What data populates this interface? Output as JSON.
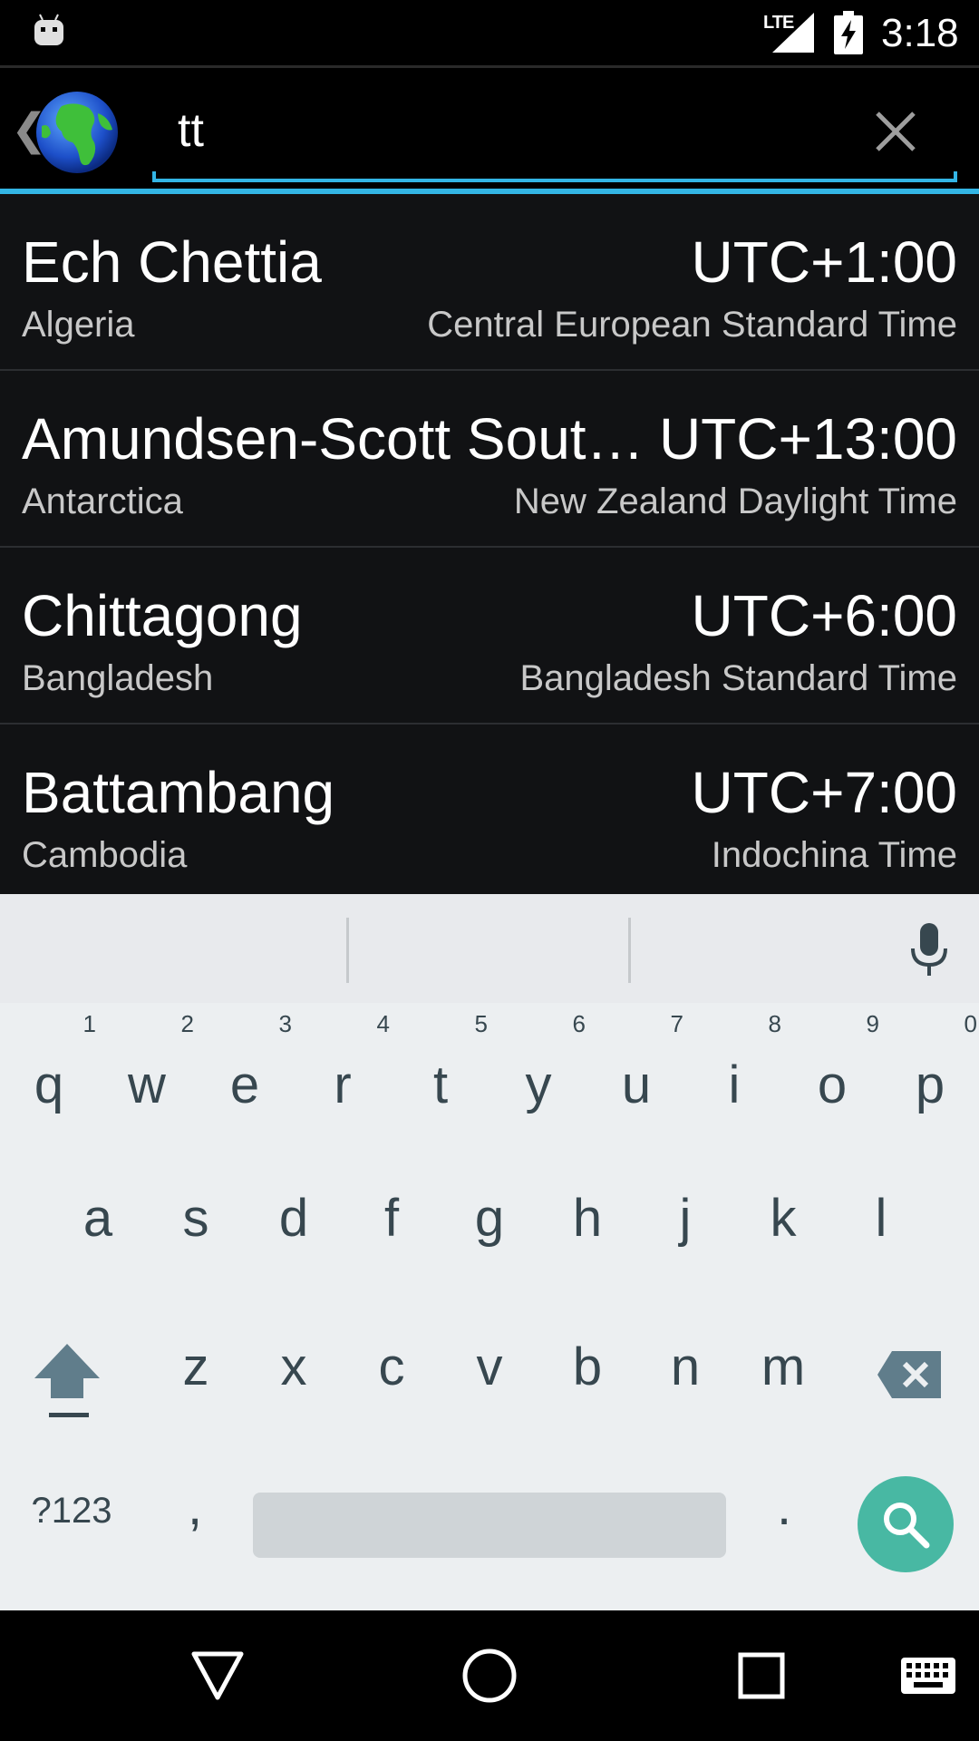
{
  "status_bar": {
    "network": "LTE",
    "time": "3:18"
  },
  "search": {
    "query": "tt"
  },
  "results": [
    {
      "city": "Ech Chettia",
      "country": "Algeria",
      "offset": "UTC+1:00",
      "zone": "Central European Standard Time"
    },
    {
      "city": "Amundsen-Scott Sout…",
      "country": "Antarctica",
      "offset": "UTC+13:00",
      "zone": "New Zealand Daylight Time"
    },
    {
      "city": "Chittagong",
      "country": "Bangladesh",
      "offset": "UTC+6:00",
      "zone": "Bangladesh Standard Time"
    },
    {
      "city": "Battambang",
      "country": "Cambodia",
      "offset": "UTC+7:00",
      "zone": "Indochina Time"
    }
  ],
  "keyboard": {
    "row1": [
      {
        "char": "q",
        "hint": "1"
      },
      {
        "char": "w",
        "hint": "2"
      },
      {
        "char": "e",
        "hint": "3"
      },
      {
        "char": "r",
        "hint": "4"
      },
      {
        "char": "t",
        "hint": "5"
      },
      {
        "char": "y",
        "hint": "6"
      },
      {
        "char": "u",
        "hint": "7"
      },
      {
        "char": "i",
        "hint": "8"
      },
      {
        "char": "o",
        "hint": "9"
      },
      {
        "char": "p",
        "hint": "0"
      }
    ],
    "row2": [
      "a",
      "s",
      "d",
      "f",
      "g",
      "h",
      "j",
      "k",
      "l"
    ],
    "row3": [
      "z",
      "x",
      "c",
      "v",
      "b",
      "n",
      "m"
    ],
    "symbols_label": "?123",
    "comma": ",",
    "period": "."
  },
  "colors": {
    "accent": "#33b5e5",
    "search_key": "#48b8a3",
    "list_bg": "#111214",
    "keyboard_bg": "#eceff1"
  },
  "icons": {
    "app": "android-icon",
    "globe": "globe-icon",
    "clear": "close-icon",
    "mic": "mic-icon",
    "shift": "shift-icon",
    "backspace": "backspace-icon",
    "search": "search-icon",
    "nav_back": "back-triangle-icon",
    "nav_home": "home-circle-icon",
    "nav_recents": "recents-square-icon",
    "nav_keyboard": "keyboard-icon"
  }
}
